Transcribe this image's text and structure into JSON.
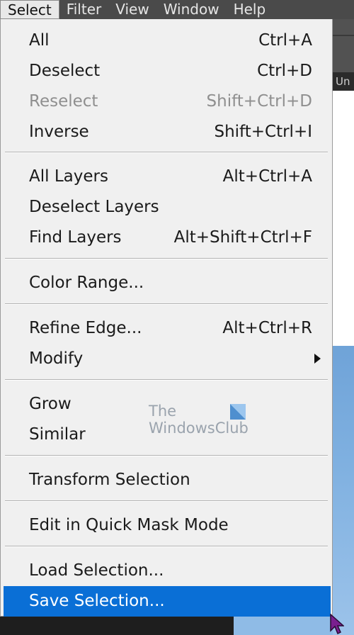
{
  "menubar": {
    "items": [
      {
        "label": "Select",
        "active": true
      },
      {
        "label": "Filter"
      },
      {
        "label": "View"
      },
      {
        "label": "Window"
      },
      {
        "label": "Help"
      }
    ]
  },
  "background": {
    "panel_tab_text": "Un"
  },
  "menu": {
    "items": [
      {
        "label": "All",
        "shortcut": "Ctrl+A"
      },
      {
        "label": "Deselect",
        "shortcut": "Ctrl+D"
      },
      {
        "label": "Reselect",
        "shortcut": "Shift+Ctrl+D",
        "disabled": true
      },
      {
        "label": "Inverse",
        "shortcut": "Shift+Ctrl+I"
      },
      {
        "label": "All Layers",
        "shortcut": "Alt+Ctrl+A"
      },
      {
        "label": "Deselect Layers",
        "shortcut": ""
      },
      {
        "label": "Find Layers",
        "shortcut": "Alt+Shift+Ctrl+F"
      },
      {
        "label": "Color Range...",
        "shortcut": ""
      },
      {
        "label": "Refine Edge...",
        "shortcut": "Alt+Ctrl+R"
      },
      {
        "label": "Modify",
        "shortcut": "",
        "submenu": true
      },
      {
        "label": "Grow",
        "shortcut": ""
      },
      {
        "label": "Similar",
        "shortcut": ""
      },
      {
        "label": "Transform Selection",
        "shortcut": ""
      },
      {
        "label": "Edit in Quick Mask Mode",
        "shortcut": ""
      },
      {
        "label": "Load Selection...",
        "shortcut": ""
      },
      {
        "label": "Save Selection...",
        "shortcut": "",
        "highlighted": true
      }
    ]
  },
  "watermark": {
    "line1": "The",
    "line2": "WindowsClub"
  },
  "colors": {
    "menubar_bg": "#4a4a4a",
    "menu_bg": "#f0f0f0",
    "highlight": "#0a6fd6",
    "disabled_text": "#8f8f8f"
  }
}
